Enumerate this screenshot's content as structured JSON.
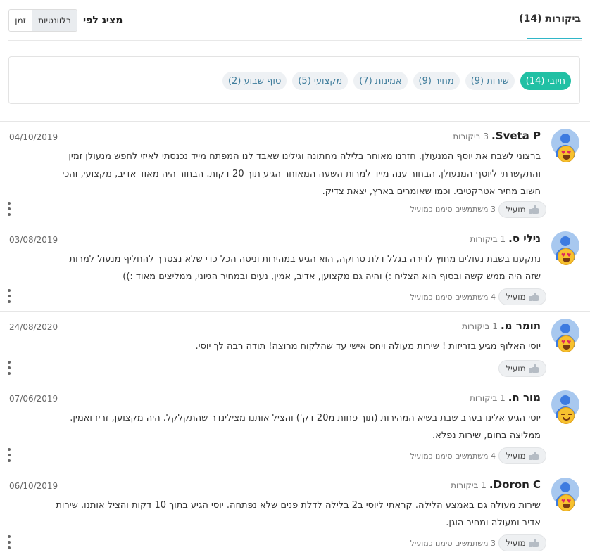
{
  "header": {
    "reviews_tab": "ביקורות (14)",
    "sort_label": "מציג לפי",
    "sort_options": {
      "relevance": "רלוונטיות",
      "time": "זמן"
    }
  },
  "filters": [
    {
      "label": "חיובי (14)",
      "active": true
    },
    {
      "label": "שירות (9)",
      "active": false
    },
    {
      "label": "מחיר (9)",
      "active": false
    },
    {
      "label": "אמינות (7)",
      "active": false
    },
    {
      "label": "מקצועי (5)",
      "active": false
    },
    {
      "label": "סוף שבוע (2)",
      "active": false
    }
  ],
  "helpful_label": "מועיל",
  "reviews": [
    {
      "name": "Sveta P.",
      "count": "3 ביקורות",
      "date": "04/10/2019",
      "text": "ברצוני לשבח את יוסף המנעולן. חזרנו מאוחר בלילה מחתונה וגילינו שאבד לנו המפתח מייד נכנסתי לאיזי לחפש מנעולן זמין והתקשרתי ליוסף המנעולן. הבחור ענה מייד למרות השעה המאוחר הגיע תוך 20 דקות. הבחור היה מאוד אדיב, מקצועי, והכי חשוב מחיר אטרקטיבי. וכמו שאומרים בארץ, יצאת צדיק.",
      "helpful_count": "3 משתמשים סימנו כמועיל",
      "emoji": "heart-eyes-icon"
    },
    {
      "name": "נילי ס.",
      "count": "1 ביקורות",
      "date": "03/08/2019",
      "text": "נתקענו בשבת נעולים מחוץ לדירה בגלל דלת טרוקה, הוא הגיע במהירות וניסה הכל כדי שלא נצטרך להחליף מנעול למרות שזה היה ממש קשה ובסוף הוא הצליח :) והיה גם מקצוען, אדיב, אמין, נעים ובמחיר הגיוני, ממליצים מאוד :))",
      "helpful_count": "4 משתמשים סימנו כמועיל",
      "emoji": "heart-eyes-icon"
    },
    {
      "name": "תומר מ.",
      "count": "1 ביקורות",
      "date": "24/08/2020",
      "text": "יוסי האלוף מגיע בזריזות ! שירות מעולה ויחס אישי עד שהלקוח מרוצה! תודה רבה לך יוסי.",
      "helpful_count": "",
      "emoji": "heart-eyes-icon"
    },
    {
      "name": "מור ח.",
      "count": "1 ביקורות",
      "date": "07/06/2019",
      "text": "יוסי הגיע אלינו בערב שבת בשיא המהירות (תוך פחות מ20 דק') והציל אותנו מצילינדר שהתקלקל. היה מקצוען, זריז ואמין. ממליצה בחום, שירות נפלא.",
      "helpful_count": "4 משתמשים סימנו כמועיל",
      "emoji": "smile-icon"
    },
    {
      "name": "Doron C.",
      "count": "1 ביקורות",
      "date": "06/10/2019",
      "text": "שירות מעולה גם באמצע הלילה. קראתי ליוסי ב2 בלילה לדלת פנים שלא נפתחה. יוסי הגיע בתוך 10 דקות והציל אותנו. שירות אדיב ומעולה ומחיר הוגן.",
      "helpful_count": "3 משתמשים סימנו כמועיל",
      "emoji": "heart-eyes-icon"
    }
  ]
}
